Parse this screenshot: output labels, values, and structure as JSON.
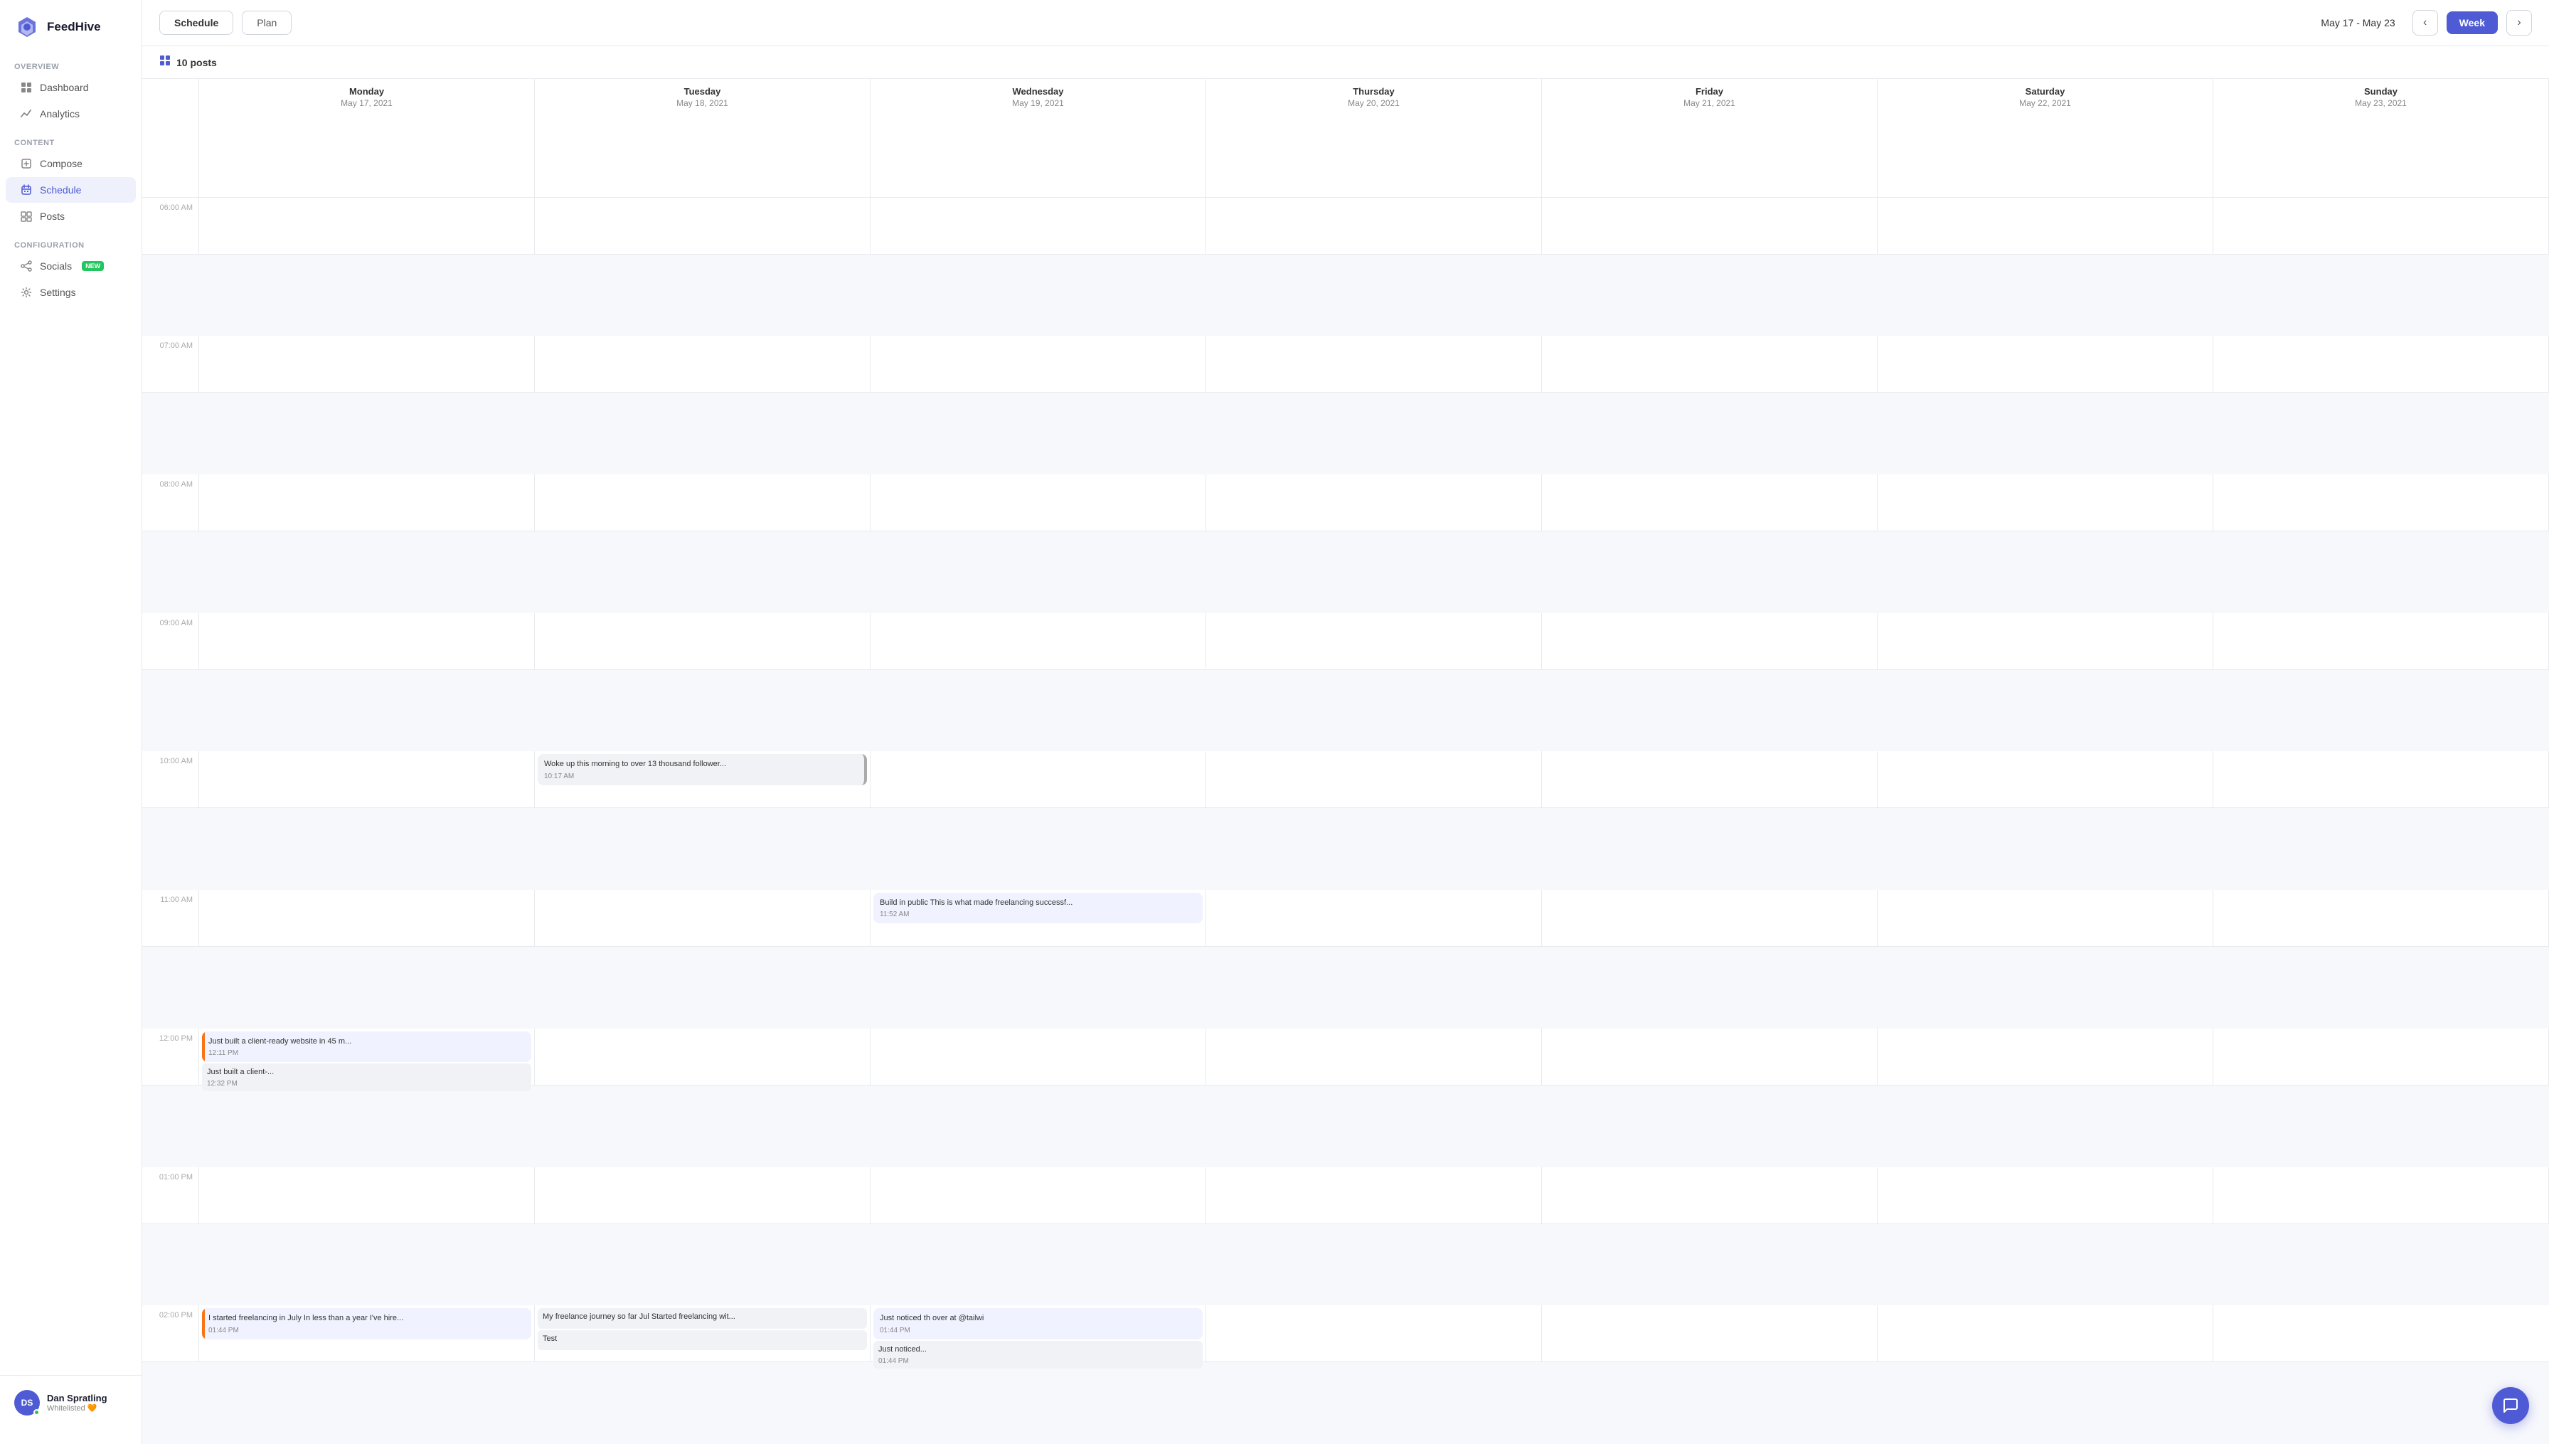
{
  "app": {
    "name": "FeedHive"
  },
  "sidebar": {
    "sections": [
      {
        "label": "Overview",
        "items": [
          {
            "id": "dashboard",
            "label": "Dashboard",
            "icon": "dashboard-icon",
            "active": false
          },
          {
            "id": "analytics",
            "label": "Analytics",
            "icon": "analytics-icon",
            "active": false
          }
        ]
      },
      {
        "label": "Content",
        "items": [
          {
            "id": "compose",
            "label": "Compose",
            "icon": "compose-icon",
            "active": false
          },
          {
            "id": "schedule",
            "label": "Schedule",
            "icon": "schedule-icon",
            "active": true
          },
          {
            "id": "posts",
            "label": "Posts",
            "icon": "posts-icon",
            "active": false
          }
        ]
      },
      {
        "label": "Configuration",
        "items": [
          {
            "id": "socials",
            "label": "Socials",
            "icon": "socials-icon",
            "active": false,
            "badge": "NEW"
          },
          {
            "id": "settings",
            "label": "Settings",
            "icon": "settings-icon",
            "active": false
          }
        ]
      }
    ],
    "user": {
      "name": "Dan Spratling",
      "status": "Whitelisted 🧡",
      "initials": "DS"
    }
  },
  "header": {
    "tabs": [
      {
        "id": "schedule",
        "label": "Schedule",
        "active": true
      },
      {
        "id": "plan",
        "label": "Plan",
        "active": false
      }
    ],
    "date_range": "May 17 - May 23",
    "week_label": "Week"
  },
  "calendar": {
    "posts_count": "10 posts",
    "days": [
      {
        "name": "Monday",
        "date": "May 17, 2021"
      },
      {
        "name": "Tuesday",
        "date": "May 18, 2021"
      },
      {
        "name": "Wednesday",
        "date": "May 19, 2021"
      },
      {
        "name": "Thursday",
        "date": "May 20, 2021"
      },
      {
        "name": "Friday",
        "date": "May 21, 2021"
      },
      {
        "name": "Saturday",
        "date": "May 22, 2021"
      },
      {
        "name": "Sunday",
        "date": "May 23, 2021"
      }
    ],
    "time_slots": [
      "06:00 AM",
      "07:00 AM",
      "08:00 AM",
      "09:00 AM",
      "10:00 AM",
      "11:00 AM",
      "12:00 PM",
      "01:00 PM",
      "02:00 PM"
    ],
    "posts": [
      {
        "day_index": 1,
        "time_slot_index": 4,
        "text": "Woke up this morning to over 13 thousand follower...",
        "time": "10:17 AM",
        "style": "gray-bar"
      },
      {
        "day_index": 2,
        "time_slot_index": 5,
        "text": "Build in public This is what made freelancing successf...",
        "time": "11:52 AM",
        "style": "default"
      },
      {
        "day_index": 0,
        "time_slot_index": 6,
        "text": "Just built a client-ready website in 45 m...",
        "time": "12:11 PM",
        "style": "orange-bar"
      },
      {
        "day_index": 0,
        "time_slot_index": 6,
        "text": "Just built a client-...",
        "time": "12:32 PM",
        "style": "mini"
      },
      {
        "day_index": 0,
        "time_slot_index": 8,
        "text": "I started freelancing in July In less than a year I've hire...",
        "time": "01:44 PM",
        "style": "orange-bar"
      },
      {
        "day_index": 2,
        "time_slot_index": 8,
        "text": "Just noticed th over at @tailwi",
        "time": "01:44 PM",
        "style": "default"
      },
      {
        "day_index": 2,
        "time_slot_index": 8,
        "text": "Just noticed...",
        "time": "01:44 PM",
        "style": "mini"
      },
      {
        "day_index": 1,
        "time_slot_index": 8,
        "text": "My freelance journey so far Jul Started freelancing wit...",
        "time": "",
        "style": "default"
      },
      {
        "day_index": 1,
        "time_slot_index": 8,
        "text": "Test",
        "time": "",
        "style": "mini"
      }
    ]
  },
  "chat_fab": {
    "icon": "chat-icon",
    "label": "Chat"
  }
}
